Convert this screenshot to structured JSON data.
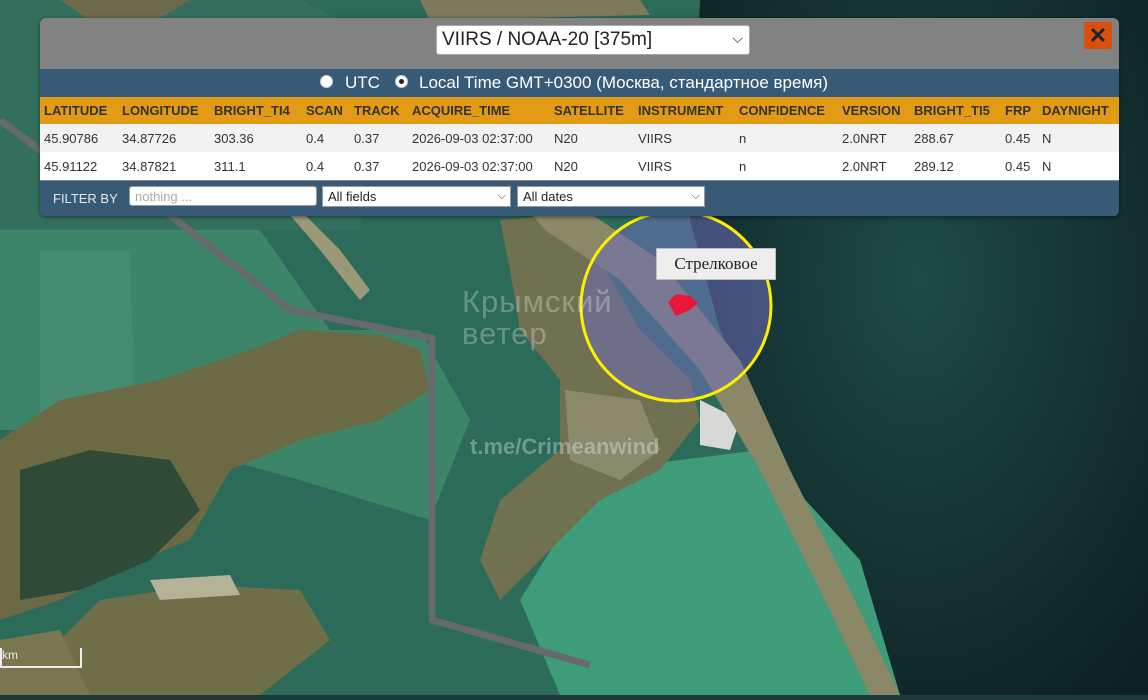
{
  "map": {
    "watermark_line1": "Крымский",
    "watermark_line2": "ветер",
    "watermark_url": "t.me/Crimeanwind",
    "place_label": "Стрелковое",
    "scale_label": "km",
    "highlight_circle_color": "#ffee00",
    "fire_marker_color": "#e8183a"
  },
  "popup": {
    "satellite_select": "VIIRS / NOAA-20 [375m]",
    "close_icon": "close-x-icon",
    "accent_color": "#d94f0b",
    "time_options": [
      {
        "label": "UTC",
        "checked": false
      },
      {
        "label": "Local Time GMT+0300 (Москва, стандартное время)",
        "checked": true
      }
    ],
    "table": {
      "headers": [
        "LATITUDE",
        "LONGITUDE",
        "BRIGHT_TI4",
        "SCAN",
        "TRACK",
        "ACQUIRE_TIME",
        "SATELLITE",
        "INSTRUMENT",
        "CONFIDENCE",
        "VERSION",
        "BRIGHT_TI5",
        "FRP",
        "DAYNIGHT"
      ],
      "rows": [
        [
          "45.90786",
          "34.87726",
          "303.36",
          "0.4",
          "0.37",
          "2026-09-03 02:37:00",
          "N20",
          "VIIRS",
          "n",
          "2.0NRT",
          "288.67",
          "0.45",
          "N"
        ],
        [
          "45.91122",
          "34.87821",
          "311.1",
          "0.4",
          "0.37",
          "2026-09-03 02:37:00",
          "N20",
          "VIIRS",
          "n",
          "2.0NRT",
          "289.12",
          "0.45",
          "N"
        ]
      ]
    },
    "filter": {
      "label": "FILTER BY",
      "placeholder": "nothing ...",
      "fields_select": "All fields",
      "dates_select": "All dates"
    }
  }
}
